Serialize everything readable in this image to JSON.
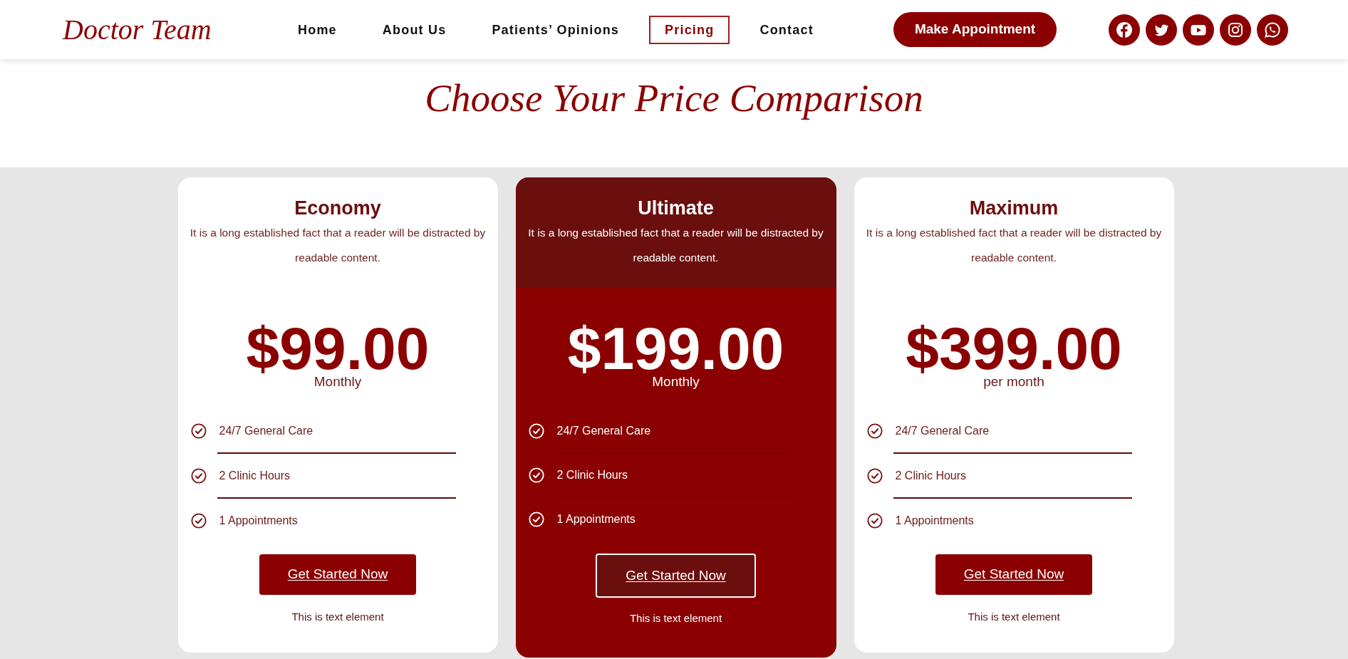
{
  "header": {
    "logo": "Doctor Team",
    "nav": [
      {
        "label": "Home",
        "selected": false
      },
      {
        "label": "About Us",
        "selected": false
      },
      {
        "label": "Patients’ Opinions",
        "selected": false
      },
      {
        "label": "Pricing",
        "selected": true
      },
      {
        "label": "Contact",
        "selected": false
      }
    ],
    "cta": "Make Appointment"
  },
  "heading": "Choose Your Price Comparison",
  "plans": [
    {
      "name": "Economy",
      "featured": false,
      "description": "It is a long established fact that a reader will be distracted by readable content.",
      "price": "$99.00",
      "period": "Monthly",
      "features": [
        "24/7 General Care",
        "2 Clinic Hours",
        "1 Appointments"
      ],
      "button": "Get Started Now",
      "note": "This is text element"
    },
    {
      "name": "Ultimate",
      "featured": true,
      "description": "It is a long established fact that a reader will be distracted by readable content.",
      "price": "$199.00",
      "period": "Monthly",
      "features": [
        "24/7 General Care",
        "2 Clinic Hours",
        "1 Appointments"
      ],
      "button": "Get Started Now",
      "note": "This is text element"
    },
    {
      "name": "Maximum",
      "featured": false,
      "description": "It is a long established fact that a reader will be distracted by readable content.",
      "price": "$399.00",
      "period": "per month",
      "features": [
        "24/7 General Care",
        "2 Clinic Hours",
        "1 Appointments"
      ],
      "button": "Get Started Now",
      "note": "This is text element"
    }
  ]
}
